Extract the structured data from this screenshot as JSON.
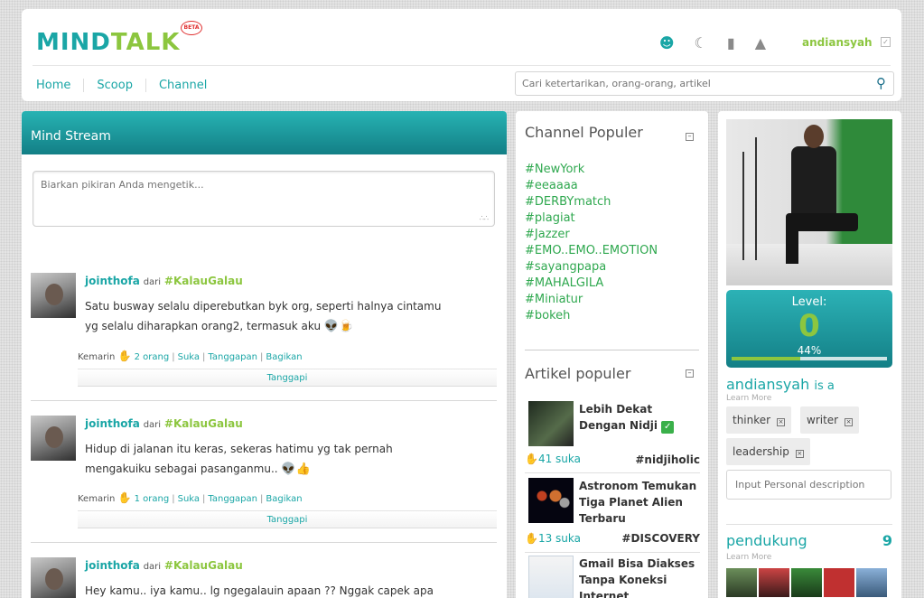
{
  "header": {
    "logo_mind": "MIND",
    "logo_talk": "TALK",
    "beta": "BETA",
    "username": "andiansyah",
    "nav": [
      "Home",
      "Scoop",
      "Channel"
    ],
    "search_placeholder": "Cari ketertarikan, orang-orang, artikel",
    "icons": [
      "people-icon",
      "ear-icon",
      "book-icon",
      "bell-icon"
    ]
  },
  "stream": {
    "title": "Mind Stream",
    "composer_placeholder": "Biarkan pikiran Anda mengetik...",
    "posts": [
      {
        "author": "jointhofa",
        "dari": "dari",
        "channel": "#KalauGalau",
        "line1": "Satu busway selalu diperebutkan byk org, seperti halnya cintamu",
        "line2": "yg selalu diharapkan orang2, termasuk aku",
        "time": "Kemarin",
        "likes": "2 orang",
        "suka": "Suka",
        "tanggapan": "Tanggapan",
        "bagikan": "Bagikan",
        "reply": "Tanggapi"
      },
      {
        "author": "jointhofa",
        "dari": "dari",
        "channel": "#KalauGalau",
        "line1": "Hidup di jalanan itu keras, sekeras hatimu yg tak pernah",
        "line2": "mengakuiku sebagai pasanganmu..",
        "time": "Kemarin",
        "likes": "1 orang",
        "suka": "Suka",
        "tanggapan": "Tanggapan",
        "bagikan": "Bagikan",
        "reply": "Tanggapi"
      },
      {
        "author": "jointhofa",
        "dari": "dari",
        "channel": "#KalauGalau",
        "line1": "Hey kamu.. iya kamu.. lg ngegalauin apaan ?? Nggak capek apa"
      }
    ]
  },
  "channels": {
    "title": "Channel Populer",
    "items": [
      "#NewYork",
      "#eeaaaa",
      "#DERBYmatch",
      "#plagiat",
      "#Jazzer",
      "#EMO..EMO..EMOTION",
      "#sayangpapa",
      "#MAHALGILA",
      "#Miniatur",
      "#bokeh"
    ]
  },
  "articles": {
    "title": "Artikel populer",
    "items": [
      {
        "title": "Lebih Dekat Dengan Nidji",
        "likes": "41 suka",
        "tag": "#nidjiholic"
      },
      {
        "title": "Astronom Temukan Tiga Planet Alien Terbaru",
        "likes": "13 suka",
        "tag": "#DISCOVERY"
      },
      {
        "title": "Gmail Bisa Diakses Tanpa Koneksi Internet",
        "likes": "",
        "tag": ""
      }
    ]
  },
  "profile": {
    "level_label": "Level:",
    "level": "0",
    "percent_text": "44%",
    "progress": 0.44,
    "name": "andiansyah",
    "is_a": "is a",
    "learn_more": "Learn More",
    "tags": [
      "thinker",
      "writer",
      "leadership"
    ],
    "desc_placeholder": "Input Personal description",
    "pendukung": "pendukung",
    "pendukung_count": "9",
    "pendukung_learn": "Learn More"
  },
  "colors": {
    "teal": "#1aa6a6",
    "green": "#8cc63f",
    "channel_green": "#2fa84f"
  }
}
